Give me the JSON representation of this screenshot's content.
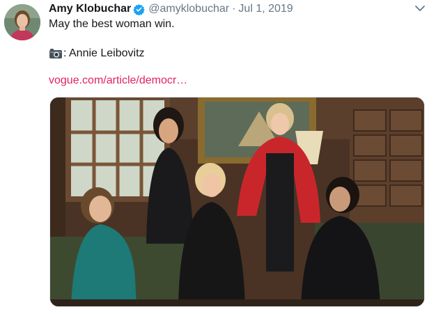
{
  "tweet": {
    "author_name": "Amy Klobuchar",
    "handle": "@amyklobuchar",
    "separator": "·",
    "date": "Jul 1, 2019",
    "text_line1": "May the best woman win.",
    "credit": ": Annie Leibovitz",
    "link": "vogue.com/article/democr…"
  },
  "icons": {
    "verified": "verified-badge-icon",
    "camera": "camera-icon",
    "more": "chevron-down-icon"
  },
  "colors": {
    "link": "#e0245e",
    "verified": "#1da1f2",
    "secondary_text": "#657786"
  }
}
